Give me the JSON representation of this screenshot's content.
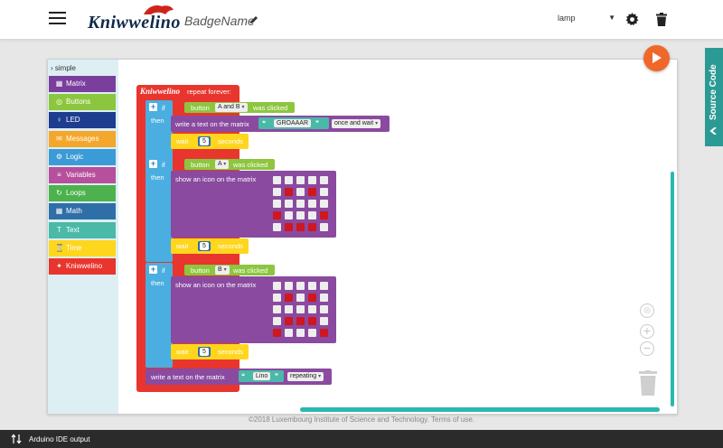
{
  "header": {
    "logo_text": "Kniwwelino",
    "project_name": "BadgeName",
    "board_select_value": "lamp"
  },
  "toolbox": {
    "heading": "simple",
    "categories": [
      {
        "label": "Matrix",
        "color": "#7a3f9d",
        "icon": "grid-icon"
      },
      {
        "label": "Buttons",
        "color": "#8cc63f",
        "icon": "target-icon"
      },
      {
        "label": "LED",
        "color": "#1e3d8f",
        "icon": "bulb-icon"
      },
      {
        "label": "Messages",
        "color": "#f4a72a",
        "icon": "envelope-icon"
      },
      {
        "label": "Logic",
        "color": "#3b9bd6",
        "icon": "logic-icon"
      },
      {
        "label": "Variables",
        "color": "#b64f9c",
        "icon": "sliders-icon"
      },
      {
        "label": "Loops",
        "color": "#4db24d",
        "icon": "loop-icon"
      },
      {
        "label": "Math",
        "color": "#2f6fa8",
        "icon": "calculator-icon"
      },
      {
        "label": "Text",
        "color": "#4bb9a8",
        "icon": "text-icon"
      },
      {
        "label": "Time",
        "color": "#ffd61e",
        "icon": "hourglass-icon"
      },
      {
        "label": "Kniwwelino",
        "color": "#e8352d",
        "icon": "logo-icon"
      }
    ]
  },
  "blocks": {
    "main_logo": "Kniwwelino",
    "main_label": "repeat forever:",
    "if1": {
      "if_label": "if",
      "then_label": "then",
      "button_prefix": "button",
      "button_value": "A and B",
      "button_suffix": "was clicked",
      "write_label": "write a text on the matrix",
      "text_value": "GROAAAR",
      "mode_value": "once and wait",
      "wait_label": "wait",
      "wait_value": "5",
      "wait_unit": "seconds"
    },
    "if2": {
      "if_label": "if",
      "then_label": "then",
      "button_prefix": "button",
      "button_value": "A",
      "button_suffix": "was clicked",
      "icon_label": "show an icon on the matrix",
      "wait_label": "wait",
      "wait_value": "5",
      "wait_unit": "seconds",
      "matrix": [
        [
          0,
          0,
          0,
          0,
          0
        ],
        [
          0,
          1,
          0,
          1,
          0
        ],
        [
          0,
          0,
          0,
          0,
          0
        ],
        [
          1,
          0,
          0,
          0,
          1
        ],
        [
          0,
          1,
          1,
          1,
          0
        ]
      ]
    },
    "if3": {
      "if_label": "if",
      "then_label": "then",
      "button_prefix": "button",
      "button_value": "B",
      "button_suffix": "was clicked",
      "icon_label": "show an icon on the matrix",
      "wait_label": "wait",
      "wait_value": "5",
      "wait_unit": "seconds",
      "matrix": [
        [
          0,
          0,
          0,
          0,
          0
        ],
        [
          0,
          1,
          0,
          1,
          0
        ],
        [
          0,
          0,
          0,
          0,
          0
        ],
        [
          0,
          1,
          1,
          1,
          0
        ],
        [
          1,
          0,
          0,
          0,
          1
        ]
      ]
    },
    "bottom": {
      "write_label": "write a text on the matrix",
      "text_value": "Lino",
      "mode_value": "repeating"
    }
  },
  "source_tab_label": "Source Code",
  "copyright": "©2018 Luxembourg Institute of Science and Technology. Terms of use.",
  "bottom_bar_label": "Arduino IDE output",
  "colors": {
    "loop_red": "#e8352d",
    "logic_blue": "#4aaee0",
    "button_green": "#8cc63f",
    "matrix_purple": "#8a4a9f",
    "time_yellow": "#ffd61e",
    "text_teal": "#4bb9a8",
    "accent_orange": "#f0672a"
  }
}
